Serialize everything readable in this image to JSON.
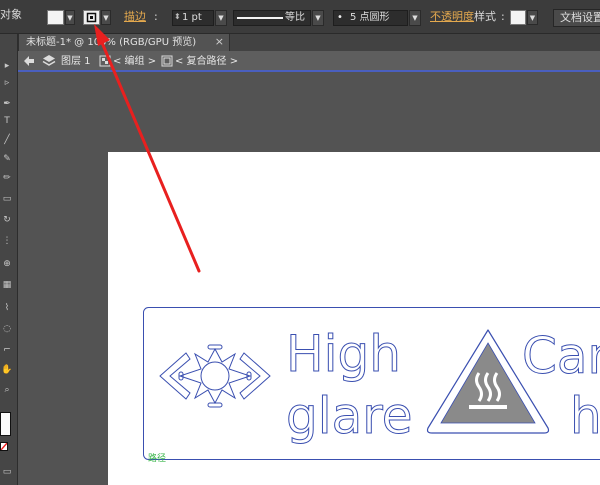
{
  "control_bar": {
    "object_label": "对象",
    "stroke_label": "描边",
    "stroke_weight": "1 pt",
    "stroke_profile": "等比",
    "brush_definition": "5 点圆形",
    "opacity_label": "不透明度",
    "style_label": "样式",
    "document_setup_label": "文档设置"
  },
  "document_tab": {
    "title": "未标题-1* @ 100% (RGB/GPU 预览)",
    "close_glyph": "×"
  },
  "breadcrumb": {
    "layer_label": "图层 1",
    "group_label": "< 编组 >",
    "compound_path_label": "< 复合路径 >"
  },
  "artwork": {
    "sign1_line1": "High",
    "sign1_line2": "glare",
    "sign2_line1": "Car",
    "sign2_line2": "h",
    "anchor_hint": "路径"
  },
  "colors": {
    "annotation_arrow": "#e8201f",
    "selection_outline": "#3a4fb0",
    "path_hint": "#39b54a"
  },
  "icons": [
    "dropdown-arrow-icon",
    "fill-stroke-icon",
    "back-arrow-icon",
    "layers-icon",
    "group-icon",
    "compound-path-icon",
    "close-icon",
    "selection-tool-icon",
    "pen-tool-icon",
    "brush-tool-icon",
    "eraser-tool-icon",
    "rotate-tool-icon",
    "eyedropper-tool-icon",
    "zoom-tool-icon"
  ]
}
